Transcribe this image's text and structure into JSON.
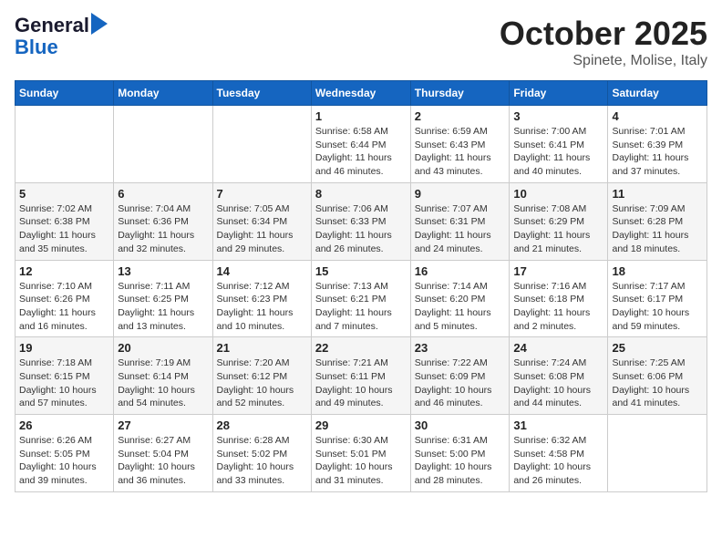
{
  "logo": {
    "line1": "General",
    "line2": "Blue"
  },
  "title": "October 2025",
  "subtitle": "Spinete, Molise, Italy",
  "days_of_week": [
    "Sunday",
    "Monday",
    "Tuesday",
    "Wednesday",
    "Thursday",
    "Friday",
    "Saturday"
  ],
  "weeks": [
    [
      {
        "day": "",
        "info": ""
      },
      {
        "day": "",
        "info": ""
      },
      {
        "day": "",
        "info": ""
      },
      {
        "day": "1",
        "info": "Sunrise: 6:58 AM\nSunset: 6:44 PM\nDaylight: 11 hours\nand 46 minutes."
      },
      {
        "day": "2",
        "info": "Sunrise: 6:59 AM\nSunset: 6:43 PM\nDaylight: 11 hours\nand 43 minutes."
      },
      {
        "day": "3",
        "info": "Sunrise: 7:00 AM\nSunset: 6:41 PM\nDaylight: 11 hours\nand 40 minutes."
      },
      {
        "day": "4",
        "info": "Sunrise: 7:01 AM\nSunset: 6:39 PM\nDaylight: 11 hours\nand 37 minutes."
      }
    ],
    [
      {
        "day": "5",
        "info": "Sunrise: 7:02 AM\nSunset: 6:38 PM\nDaylight: 11 hours\nand 35 minutes."
      },
      {
        "day": "6",
        "info": "Sunrise: 7:04 AM\nSunset: 6:36 PM\nDaylight: 11 hours\nand 32 minutes."
      },
      {
        "day": "7",
        "info": "Sunrise: 7:05 AM\nSunset: 6:34 PM\nDaylight: 11 hours\nand 29 minutes."
      },
      {
        "day": "8",
        "info": "Sunrise: 7:06 AM\nSunset: 6:33 PM\nDaylight: 11 hours\nand 26 minutes."
      },
      {
        "day": "9",
        "info": "Sunrise: 7:07 AM\nSunset: 6:31 PM\nDaylight: 11 hours\nand 24 minutes."
      },
      {
        "day": "10",
        "info": "Sunrise: 7:08 AM\nSunset: 6:29 PM\nDaylight: 11 hours\nand 21 minutes."
      },
      {
        "day": "11",
        "info": "Sunrise: 7:09 AM\nSunset: 6:28 PM\nDaylight: 11 hours\nand 18 minutes."
      }
    ],
    [
      {
        "day": "12",
        "info": "Sunrise: 7:10 AM\nSunset: 6:26 PM\nDaylight: 11 hours\nand 16 minutes."
      },
      {
        "day": "13",
        "info": "Sunrise: 7:11 AM\nSunset: 6:25 PM\nDaylight: 11 hours\nand 13 minutes."
      },
      {
        "day": "14",
        "info": "Sunrise: 7:12 AM\nSunset: 6:23 PM\nDaylight: 11 hours\nand 10 minutes."
      },
      {
        "day": "15",
        "info": "Sunrise: 7:13 AM\nSunset: 6:21 PM\nDaylight: 11 hours\nand 7 minutes."
      },
      {
        "day": "16",
        "info": "Sunrise: 7:14 AM\nSunset: 6:20 PM\nDaylight: 11 hours\nand 5 minutes."
      },
      {
        "day": "17",
        "info": "Sunrise: 7:16 AM\nSunset: 6:18 PM\nDaylight: 11 hours\nand 2 minutes."
      },
      {
        "day": "18",
        "info": "Sunrise: 7:17 AM\nSunset: 6:17 PM\nDaylight: 10 hours\nand 59 minutes."
      }
    ],
    [
      {
        "day": "19",
        "info": "Sunrise: 7:18 AM\nSunset: 6:15 PM\nDaylight: 10 hours\nand 57 minutes."
      },
      {
        "day": "20",
        "info": "Sunrise: 7:19 AM\nSunset: 6:14 PM\nDaylight: 10 hours\nand 54 minutes."
      },
      {
        "day": "21",
        "info": "Sunrise: 7:20 AM\nSunset: 6:12 PM\nDaylight: 10 hours\nand 52 minutes."
      },
      {
        "day": "22",
        "info": "Sunrise: 7:21 AM\nSunset: 6:11 PM\nDaylight: 10 hours\nand 49 minutes."
      },
      {
        "day": "23",
        "info": "Sunrise: 7:22 AM\nSunset: 6:09 PM\nDaylight: 10 hours\nand 46 minutes."
      },
      {
        "day": "24",
        "info": "Sunrise: 7:24 AM\nSunset: 6:08 PM\nDaylight: 10 hours\nand 44 minutes."
      },
      {
        "day": "25",
        "info": "Sunrise: 7:25 AM\nSunset: 6:06 PM\nDaylight: 10 hours\nand 41 minutes."
      }
    ],
    [
      {
        "day": "26",
        "info": "Sunrise: 6:26 AM\nSunset: 5:05 PM\nDaylight: 10 hours\nand 39 minutes."
      },
      {
        "day": "27",
        "info": "Sunrise: 6:27 AM\nSunset: 5:04 PM\nDaylight: 10 hours\nand 36 minutes."
      },
      {
        "day": "28",
        "info": "Sunrise: 6:28 AM\nSunset: 5:02 PM\nDaylight: 10 hours\nand 33 minutes."
      },
      {
        "day": "29",
        "info": "Sunrise: 6:30 AM\nSunset: 5:01 PM\nDaylight: 10 hours\nand 31 minutes."
      },
      {
        "day": "30",
        "info": "Sunrise: 6:31 AM\nSunset: 5:00 PM\nDaylight: 10 hours\nand 28 minutes."
      },
      {
        "day": "31",
        "info": "Sunrise: 6:32 AM\nSunset: 4:58 PM\nDaylight: 10 hours\nand 26 minutes."
      },
      {
        "day": "",
        "info": ""
      }
    ]
  ]
}
